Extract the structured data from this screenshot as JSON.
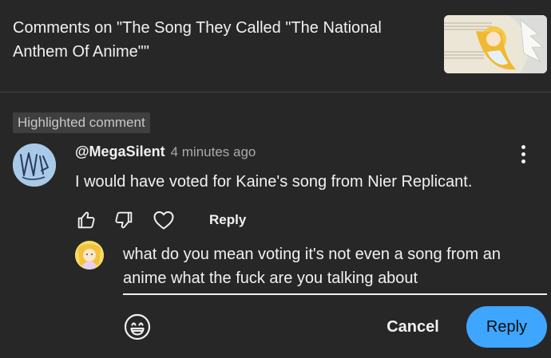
{
  "header": {
    "title": "Comments on \"The Song They Called \"The National Anthem Of Anime\"\""
  },
  "highlight": {
    "label": "Highlighted comment"
  },
  "comment": {
    "author": "@MegaSilent",
    "timestamp": "4 minutes ago",
    "text": "I would have voted for Kaine's song from Nier Replicant.",
    "reply_label": "Reply"
  },
  "reply_box": {
    "text": "what do you mean voting it's not even a song from an anime what the fuck are you talking about"
  },
  "actions": {
    "cancel_label": "Cancel",
    "submit_label": "Reply"
  },
  "icons": {
    "like": "thumbs-up-icon",
    "dislike": "thumbs-down-icon",
    "heart": "heart-icon",
    "more": "more-vertical-icon",
    "emoji": "emoji-icon"
  },
  "colors": {
    "background": "#272727",
    "accent": "#3ea6ff",
    "text": "#f1f1f1",
    "muted": "#aaaaaa"
  }
}
